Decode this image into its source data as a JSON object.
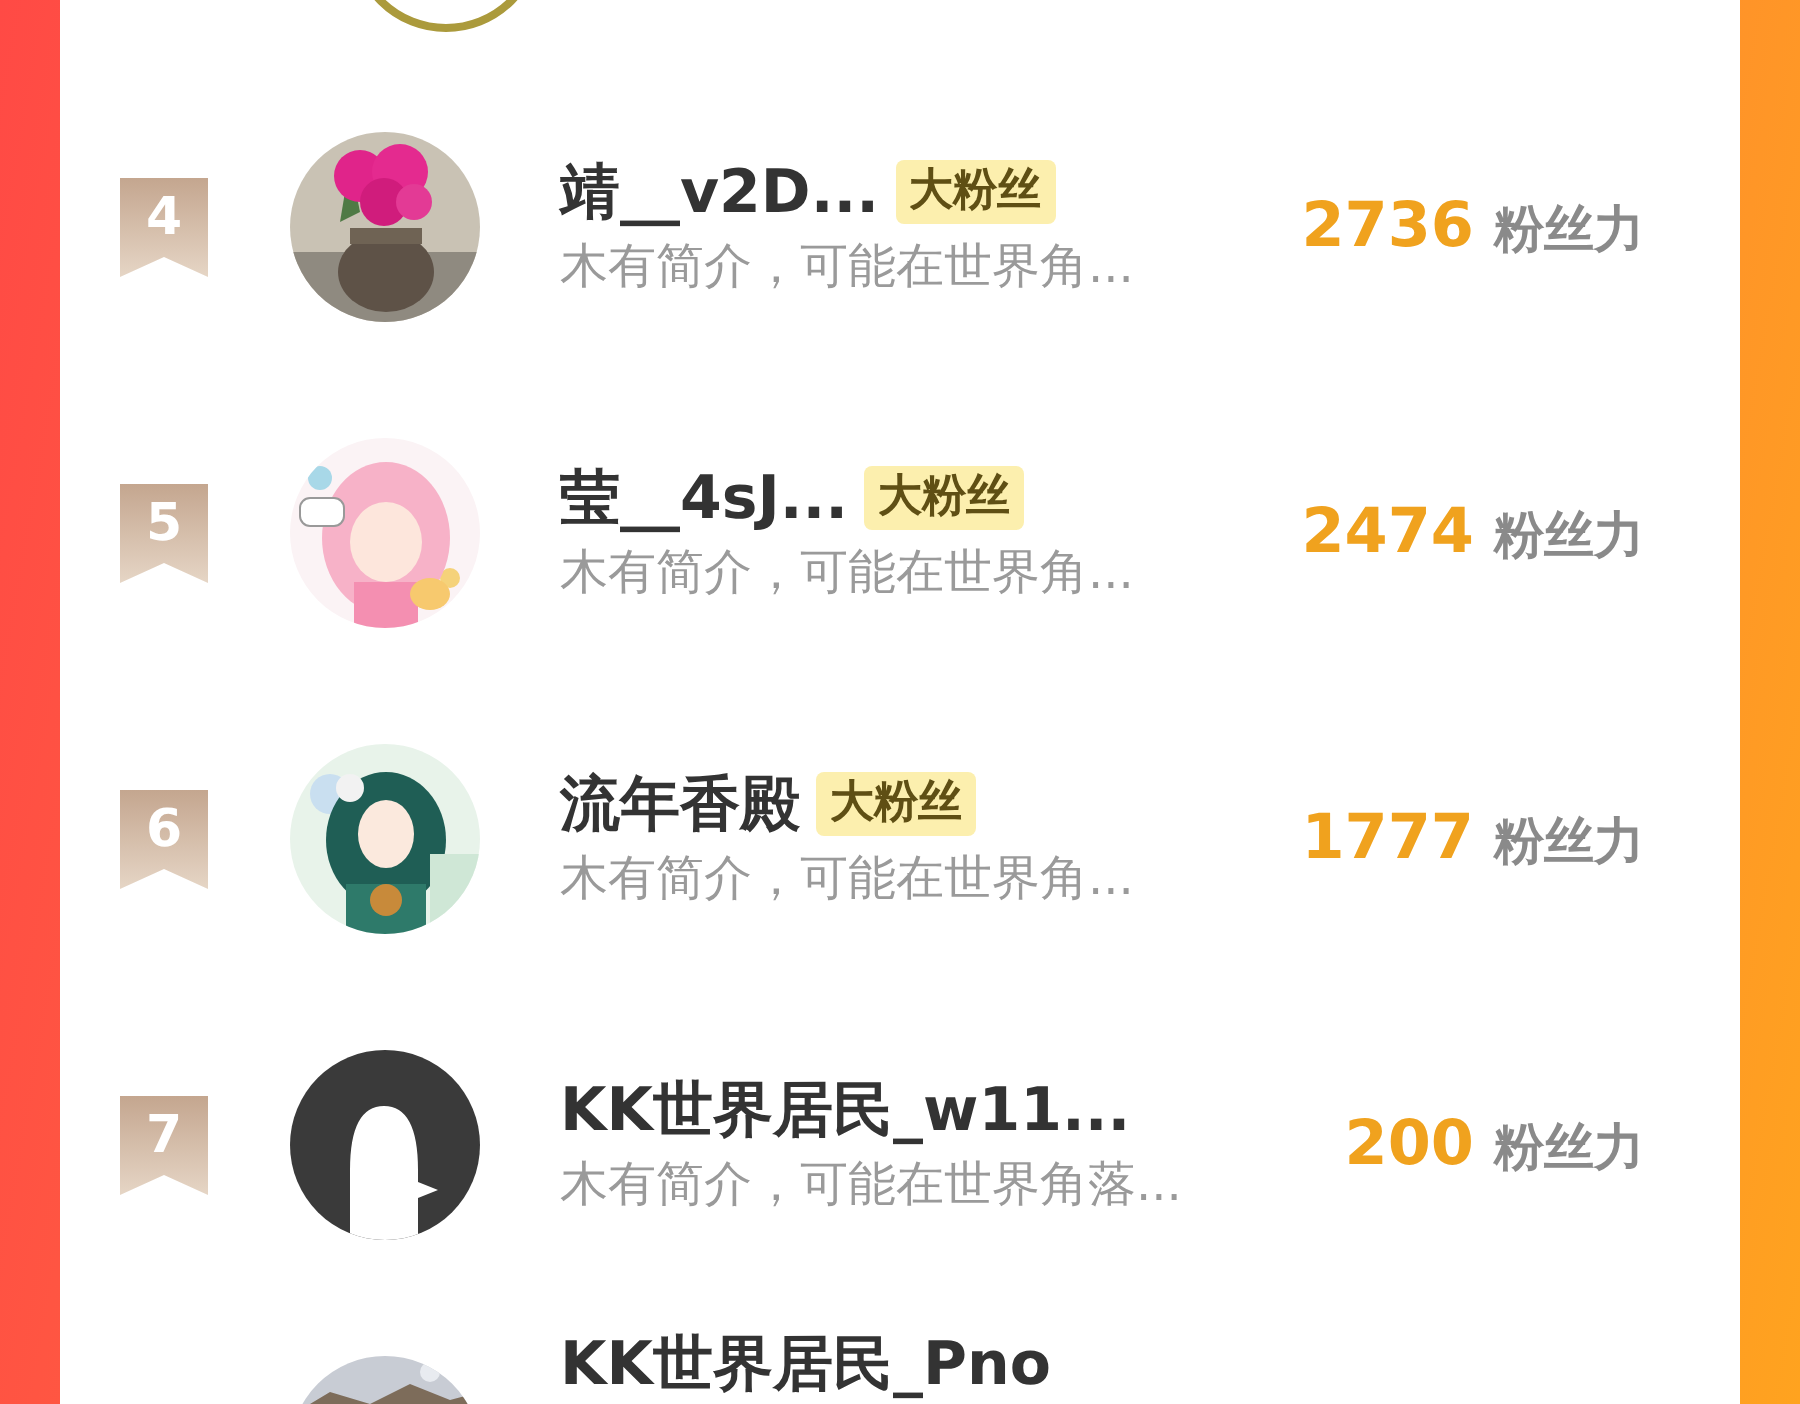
{
  "rows": [
    {
      "rank": "4",
      "name": "靖__v2D...",
      "badge": "大粉丝",
      "bio": "木有简介，可能在世界角...",
      "score": "2736",
      "score_label": "粉丝力"
    },
    {
      "rank": "5",
      "name": "莹__4sJ...",
      "badge": "大粉丝",
      "bio": "木有简介，可能在世界角...",
      "score": "2474",
      "score_label": "粉丝力"
    },
    {
      "rank": "6",
      "name": "流年香殿",
      "badge": "大粉丝",
      "bio": "木有简介，可能在世界角...",
      "score": "1777",
      "score_label": "粉丝力"
    },
    {
      "rank": "7",
      "avatar": {
        "kind": "default"
      },
      "name": "KK世界居民_w11...",
      "bio": "木有简介，可能在世界角落...",
      "score": "200",
      "score_label": "粉丝力"
    },
    {
      "name": "KK世界居民_Pno"
    }
  ]
}
